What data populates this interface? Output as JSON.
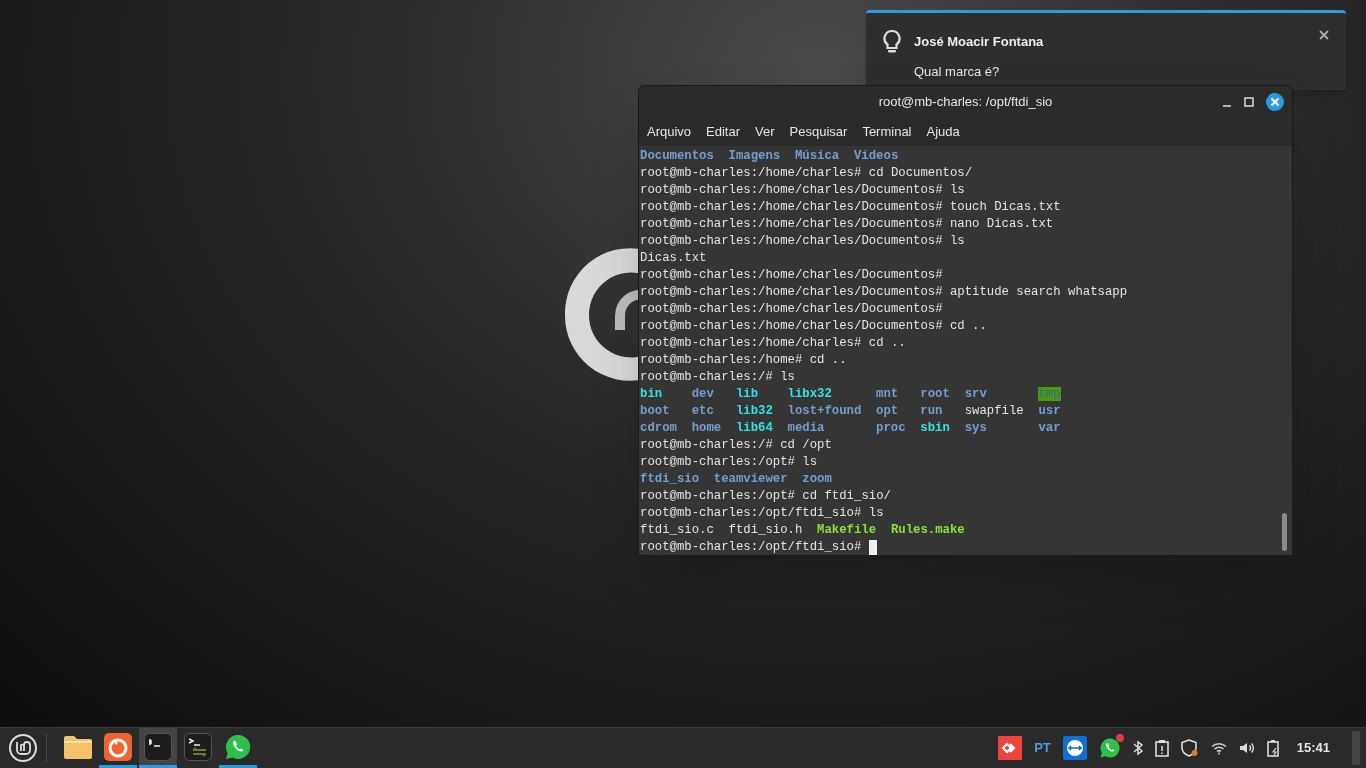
{
  "notification": {
    "title": "José Moacir Fontana",
    "body": "Qual marca é?"
  },
  "terminal": {
    "title": "root@mb-charles: /opt/ftdi_sio",
    "menu": [
      "Arquivo",
      "Editar",
      "Ver",
      "Pesquisar",
      "Terminal",
      "Ajuda"
    ],
    "lines": [
      {
        "kind": "listing",
        "rows": [
          [
            {
              "text": "Documentos",
              "kind": "dir"
            },
            {
              "text": "Imagens",
              "kind": "dir"
            },
            {
              "text": "Música",
              "kind": "dir"
            },
            {
              "text": "Vídeos",
              "kind": "dir"
            }
          ]
        ]
      },
      {
        "kind": "text",
        "text": "root@mb-charles:/home/charles# cd Documentos/"
      },
      {
        "kind": "text",
        "text": "root@mb-charles:/home/charles/Documentos# ls"
      },
      {
        "kind": "text",
        "text": "root@mb-charles:/home/charles/Documentos# touch Dicas.txt"
      },
      {
        "kind": "text",
        "text": "root@mb-charles:/home/charles/Documentos# nano Dicas.txt"
      },
      {
        "kind": "text",
        "text": "root@mb-charles:/home/charles/Documentos# ls"
      },
      {
        "kind": "text",
        "text": "Dicas.txt"
      },
      {
        "kind": "text",
        "text": "root@mb-charles:/home/charles/Documentos#"
      },
      {
        "kind": "text",
        "text": "root@mb-charles:/home/charles/Documentos# aptitude search whatsapp"
      },
      {
        "kind": "text",
        "text": "root@mb-charles:/home/charles/Documentos#"
      },
      {
        "kind": "text",
        "text": "root@mb-charles:/home/charles/Documentos# cd .."
      },
      {
        "kind": "text",
        "text": "root@mb-charles:/home/charles# cd .."
      },
      {
        "kind": "text",
        "text": "root@mb-charles:/home# cd .."
      },
      {
        "kind": "text",
        "text": "root@mb-charles:/# ls"
      },
      {
        "kind": "listing",
        "rows": [
          [
            {
              "text": "bin",
              "kind": "link"
            },
            {
              "text": "dev",
              "kind": "dir"
            },
            {
              "text": "lib",
              "kind": "link"
            },
            {
              "text": "libx32",
              "kind": "link"
            },
            {
              "text": "mnt",
              "kind": "dir"
            },
            {
              "text": "root",
              "kind": "dir"
            },
            {
              "text": "srv",
              "kind": "dir"
            },
            {
              "text": "tmp",
              "kind": "sticky"
            }
          ],
          [
            {
              "text": "boot",
              "kind": "dir"
            },
            {
              "text": "etc",
              "kind": "dir"
            },
            {
              "text": "lib32",
              "kind": "link"
            },
            {
              "text": "lost+found",
              "kind": "dir"
            },
            {
              "text": "opt",
              "kind": "dir"
            },
            {
              "text": "run",
              "kind": "dir"
            },
            {
              "text": "swapfile",
              "kind": "file"
            },
            {
              "text": "usr",
              "kind": "dir"
            }
          ],
          [
            {
              "text": "cdrom",
              "kind": "dir"
            },
            {
              "text": "home",
              "kind": "dir"
            },
            {
              "text": "lib64",
              "kind": "link"
            },
            {
              "text": "media",
              "kind": "dir"
            },
            {
              "text": "proc",
              "kind": "dir"
            },
            {
              "text": "sbin",
              "kind": "link"
            },
            {
              "text": "sys",
              "kind": "dir"
            },
            {
              "text": "var",
              "kind": "dir"
            }
          ]
        ]
      },
      {
        "kind": "text",
        "text": "root@mb-charles:/# cd /opt"
      },
      {
        "kind": "text",
        "text": "root@mb-charles:/opt# ls"
      },
      {
        "kind": "listing",
        "rows": [
          [
            {
              "text": "ftdi_sio",
              "kind": "dir"
            },
            {
              "text": "teamviewer",
              "kind": "dir"
            },
            {
              "text": "zoom",
              "kind": "dir"
            }
          ]
        ]
      },
      {
        "kind": "text",
        "text": "root@mb-charles:/opt# cd ftdi_sio/"
      },
      {
        "kind": "text",
        "text": "root@mb-charles:/opt/ftdi_sio# ls"
      },
      {
        "kind": "listing",
        "rows": [
          [
            {
              "text": "ftdi_sio.c",
              "kind": "file"
            },
            {
              "text": "ftdi_sio.h",
              "kind": "file"
            },
            {
              "text": "Makefile",
              "kind": "exec"
            },
            {
              "text": "Rules.make",
              "kind": "exec"
            }
          ]
        ]
      },
      {
        "kind": "prompt",
        "text": "root@mb-charles:/opt/ftdi_sio#"
      }
    ]
  },
  "taskbar": {
    "apps": [
      {
        "kind": "files",
        "running": false,
        "selected": false
      },
      {
        "kind": "browser",
        "running": true,
        "selected": false
      },
      {
        "kind": "terminal",
        "running": true,
        "selected": true
      },
      {
        "kind": "terminal-alt",
        "running": false,
        "selected": false
      },
      {
        "kind": "whatsapp",
        "running": true,
        "selected": false
      }
    ],
    "language": "PT",
    "clock": "15:41"
  }
}
